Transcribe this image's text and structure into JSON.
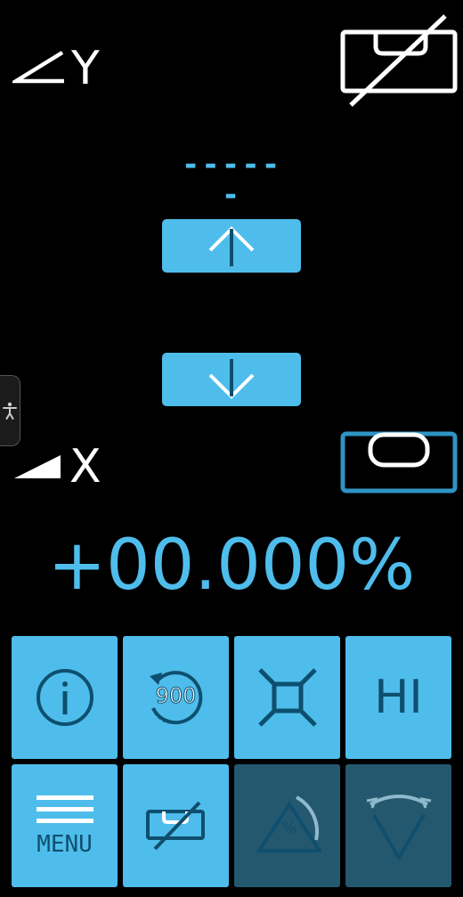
{
  "y_axis": {
    "label": "Y",
    "symbol": "angle-icon"
  },
  "x_axis": {
    "label": "X",
    "symbol": "wedge-icon"
  },
  "y_value": "------",
  "readout": "+00.000%",
  "tiles": [
    {
      "id": "info",
      "label": "",
      "icon": "info-icon"
    },
    {
      "id": "rotate900",
      "label": "900",
      "icon": "rotate-icon"
    },
    {
      "id": "calibrate",
      "label": "",
      "icon": "square-crosshair-icon"
    },
    {
      "id": "hi",
      "label": "HI",
      "icon": ""
    },
    {
      "id": "menu",
      "label": "MENU",
      "icon": "hamburger-icon"
    },
    {
      "id": "level-off",
      "label": "",
      "icon": "level-off-icon"
    },
    {
      "id": "percent-slope",
      "label": "%",
      "icon": "slope-percent-icon"
    },
    {
      "id": "arc",
      "label": "",
      "icon": "arc-triangle-icon"
    }
  ],
  "colors": {
    "accent": "#4FBDEB",
    "accent_dark": "#0E4F6F",
    "tile_disabled": "#24586E",
    "background": "#000000"
  }
}
